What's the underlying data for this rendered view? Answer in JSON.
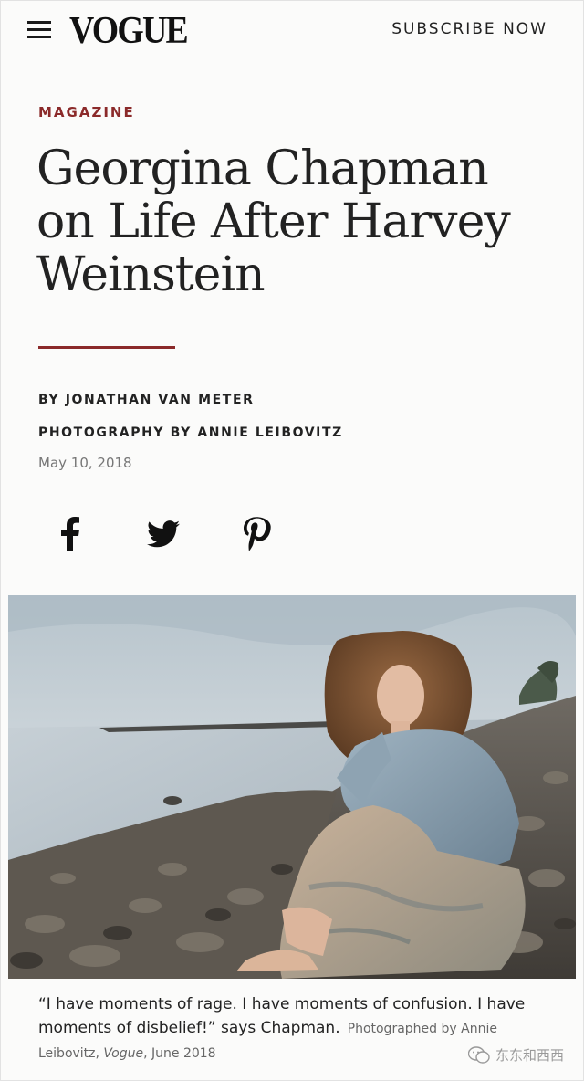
{
  "header": {
    "logo": "VOGUE",
    "subscribe_label": "SUBSCRIBE NOW"
  },
  "article": {
    "category": "MAGAZINE",
    "title": "Georgina Chapman on Life After Harvey Weinstein",
    "author_line": "BY JONATHAN VAN METER",
    "photography_line": "PHOTOGRAPHY BY ANNIE LEIBOVITZ",
    "date": "May 10, 2018"
  },
  "social": {
    "items": [
      "facebook-icon",
      "twitter-icon",
      "pinterest-icon"
    ]
  },
  "caption": {
    "quote": "“I have moments of rage. I have moments of confusion. I have moments of disbelief!” says Chapman.",
    "credit_prefix": "Photographed by Annie Leibovitz, ",
    "credit_publication": "Vogue",
    "credit_suffix": ", June 2018"
  },
  "watermark": {
    "text": "东东和西西"
  },
  "colors": {
    "accent": "#8b2a2a",
    "text": "#1a1a1a",
    "muted": "#777777",
    "background": "#fbfbfa"
  }
}
